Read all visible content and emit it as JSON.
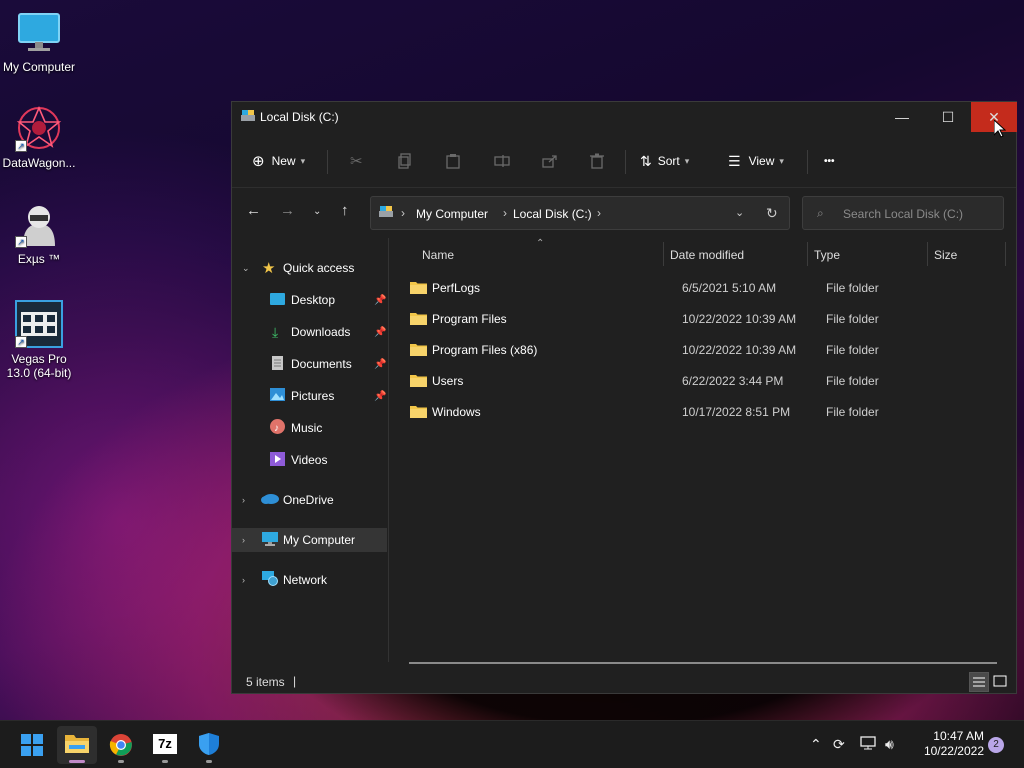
{
  "desktop": {
    "icons": [
      {
        "label": "My Computer",
        "icon": "monitor-icon"
      },
      {
        "label": "DataWagon...",
        "icon": "datawagon-app-icon"
      },
      {
        "label": "Exµs ™",
        "icon": "hacker-avatar-icon"
      },
      {
        "label": "Vegas Pro 13.0 (64-bit)",
        "icon": "film-strip-icon"
      }
    ]
  },
  "window": {
    "title": "Local Disk (C:)",
    "controls": {
      "minimize": "—",
      "maximize": "☐",
      "close": "✕"
    }
  },
  "toolbar": {
    "new_label": "New",
    "sort_label": "Sort",
    "view_label": "View",
    "more_label": "•••"
  },
  "address": {
    "crumbs": [
      "My Computer",
      "Local Disk (C:)"
    ],
    "separator": "›"
  },
  "search": {
    "placeholder": "Search Local Disk (C:)"
  },
  "nav": {
    "quick_access": "Quick access",
    "items": [
      {
        "label": "Desktop",
        "pinned": true
      },
      {
        "label": "Downloads",
        "pinned": true
      },
      {
        "label": "Documents",
        "pinned": true
      },
      {
        "label": "Pictures",
        "pinned": true
      },
      {
        "label": "Music",
        "pinned": false
      },
      {
        "label": "Videos",
        "pinned": false
      }
    ],
    "onedrive": "OneDrive",
    "my_computer": "My Computer",
    "network": "Network",
    "selected": "My Computer"
  },
  "columns": {
    "name": "Name",
    "date": "Date modified",
    "type": "Type",
    "size": "Size"
  },
  "files": [
    {
      "name": "PerfLogs",
      "date": "6/5/2021 5:10 AM",
      "type": "File folder"
    },
    {
      "name": "Program Files",
      "date": "10/22/2022 10:39 AM",
      "type": "File folder"
    },
    {
      "name": "Program Files (x86)",
      "date": "10/22/2022 10:39 AM",
      "type": "File folder"
    },
    {
      "name": "Users",
      "date": "6/22/2022 3:44 PM",
      "type": "File folder"
    },
    {
      "name": "Windows",
      "date": "10/17/2022 8:51 PM",
      "type": "File folder"
    }
  ],
  "status": {
    "count": "5 items",
    "caret": "|"
  },
  "taskbar": {
    "apps": [
      "start-icon",
      "file-explorer-icon",
      "chrome-icon",
      "7zip-icon",
      "defender-shield-icon"
    ],
    "sevenzip_label": "7z",
    "time": "10:47 AM",
    "date": "10/22/2022",
    "notifications": "2"
  },
  "colors": {
    "accent": "#0078d4",
    "close_hover": "#c42b1c",
    "folder": "#f2c649"
  }
}
